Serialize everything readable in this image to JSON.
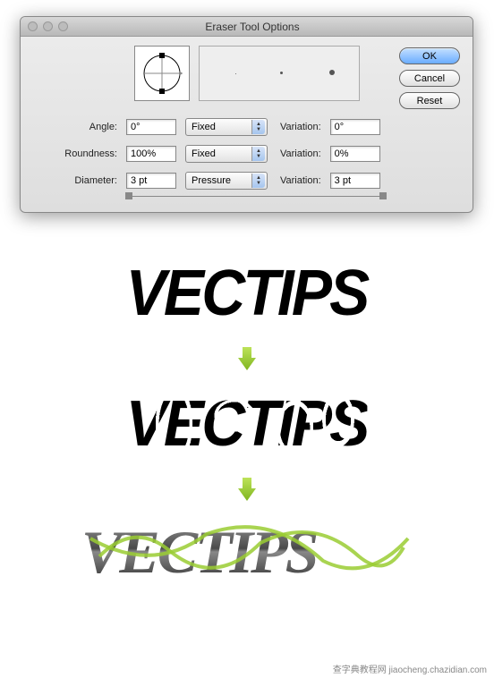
{
  "dialog": {
    "title": "Eraser Tool Options",
    "buttons": {
      "ok": "OK",
      "cancel": "Cancel",
      "reset": "Reset"
    },
    "rows": {
      "angle": {
        "label": "Angle:",
        "value": "0°",
        "mode": "Fixed",
        "var_label": "Variation:",
        "var_value": "0°"
      },
      "roundness": {
        "label": "Roundness:",
        "value": "100%",
        "mode": "Fixed",
        "var_label": "Variation:",
        "var_value": "0%"
      },
      "diameter": {
        "label": "Diameter:",
        "value": "3 pt",
        "mode": "Pressure",
        "var_label": "Variation:",
        "var_value": "3 pt"
      }
    }
  },
  "samples": {
    "text": "VECTIPS"
  },
  "watermark": "查字典教程网 jiaocheng.chazidian.com"
}
